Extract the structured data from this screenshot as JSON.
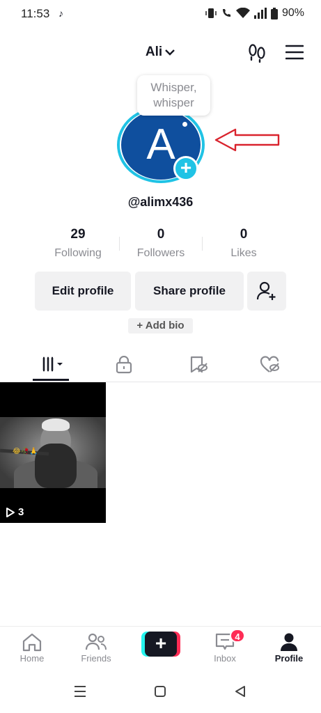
{
  "status_bar": {
    "time": "11:53",
    "tiktok_glyph": "♪",
    "battery": "90%",
    "icons": [
      "vibrate-icon",
      "wifi-call-icon",
      "wifi-icon",
      "signal-icon",
      "battery-icon"
    ]
  },
  "header": {
    "account_name": "Ali"
  },
  "profile": {
    "avatar_letter": "A",
    "note_bubble": "Whisper, whisper",
    "username": "@alimx436",
    "avatar_color": "#0f4f9e",
    "ring_color": "#20c3e5"
  },
  "stats": [
    {
      "value": "29",
      "label": "Following"
    },
    {
      "value": "0",
      "label": "Followers"
    },
    {
      "value": "0",
      "label": "Likes"
    }
  ],
  "actions": {
    "edit_profile": "Edit profile",
    "share_profile": "Share profile",
    "add_bio": "+ Add bio"
  },
  "tabs": [
    "videos-grid-icon",
    "private-lock-icon",
    "saved-bookmark-icon",
    "liked-heart-icon"
  ],
  "videos": [
    {
      "plays": "3",
      "caption_emoji": "😂🥀🙏"
    }
  ],
  "bottom_nav": {
    "home": "Home",
    "friends": "Friends",
    "create": "+",
    "inbox": "Inbox",
    "inbox_badge": "4",
    "profile": "Profile"
  },
  "colors": {
    "accent_red": "#fe2c55",
    "accent_cyan": "#25f4ee",
    "annotation_arrow": "#d9232d"
  }
}
